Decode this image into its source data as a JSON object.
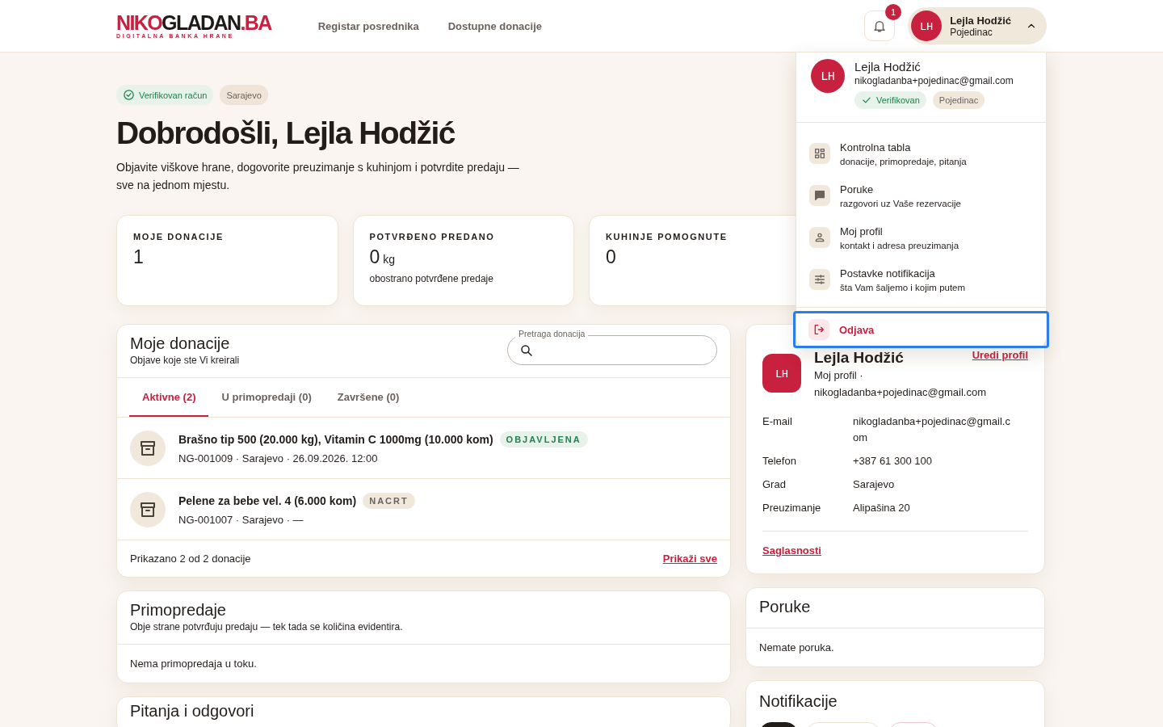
{
  "header": {
    "logo": {
      "parts": [
        {
          "text": "NIKO",
          "color": "#c8203f"
        },
        {
          "text": "GLADAN",
          "color": "#1f1a17"
        },
        {
          "text": ".BA",
          "color": "#c8203f"
        }
      ],
      "tagline": "DIGITALNA BANKA HRANE"
    },
    "nav": [
      {
        "label": "Registar posrednika"
      },
      {
        "label": "Dostupne donacije"
      }
    ],
    "notifications_badge": "1",
    "user": {
      "initials": "LH",
      "name": "Lejla Hodžić",
      "role": "Pojedinac",
      "expanded": true
    }
  },
  "user_menu": {
    "initials": "LH",
    "name": "Lejla Hodžić",
    "email": "nikogladanba+pojedinac@gmail.com",
    "chips": [
      {
        "label": "Verifikovan",
        "kind": "verified"
      },
      {
        "label": "Pojedinac",
        "kind": "plain"
      }
    ],
    "items": [
      {
        "kind": "dashboard",
        "title": "Kontrolna tabla",
        "subtitle": "donacije, primopredaje, pitanja"
      },
      {
        "kind": "messages",
        "title": "Poruke",
        "subtitle": "razgovori uz Vaše rezervacije"
      },
      {
        "kind": "profile",
        "title": "Moj profil",
        "subtitle": "kontakt i adresa preuzimanja"
      },
      {
        "kind": "settings",
        "title": "Postavke notifikacija",
        "subtitle": "šta Vam šaljemo i kojim putem"
      }
    ],
    "logout": {
      "label": "Odjava",
      "focused": true
    }
  },
  "hero": {
    "badges": [
      {
        "label": "Verifikovan račun",
        "kind": "verified"
      },
      {
        "label": "Sarajevo",
        "kind": "plain"
      }
    ],
    "title": "Dobrodošli, Lejla Hodžić",
    "subtitle": "Objavite viškove hrane, dogovorite preuzimanje s kuhinjom i potvrdite predaju — sve na jednom mjestu."
  },
  "stats": [
    {
      "label": "MOJE DONACIJE",
      "value": "1"
    },
    {
      "label": "POTVRĐENO PREDANO",
      "value": "0",
      "unit": "kg",
      "note": "obostrano potvrđene predaje"
    },
    {
      "label": "KUHINJE POMOGNUTE",
      "value": "0"
    }
  ],
  "donations": {
    "title": "Moje donacije",
    "subtitle": "Objave koje ste Vi kreirali",
    "search_label": "Pretraga donacija",
    "tabs": [
      {
        "label": "Aktivne (2)",
        "selected": true
      },
      {
        "label": "U primopredaji (0)",
        "selected": false
      },
      {
        "label": "Završene (0)",
        "selected": false
      }
    ],
    "rows": [
      {
        "title": "Brašno tip 500 (20.000 kg), Vitamin C 1000mg (10.000 kom)",
        "status": {
          "text": "OBJAVLJENA",
          "kind": "published"
        },
        "meta": "NG-001009 · Sarajevo · 26.09.2026. 12:00"
      },
      {
        "title": "Pelene za bebe vel. 4 (6.000 kom)",
        "status": {
          "text": "NACRT",
          "kind": "draft"
        },
        "meta": "NG-001007 · Sarajevo · —"
      }
    ],
    "footer": "Prikazano 2 od 2 donacije",
    "show_all": "Prikaži sve"
  },
  "handovers": {
    "title": "Primopredaje",
    "subtitle": "Obje strane potvrđuju predaju — tek tada se količina evidentira.",
    "empty": "Nema primopredaja u toku."
  },
  "qa": {
    "title": "Pitanja i odgovori"
  },
  "profile": {
    "initials": "LH",
    "name": "Lejla Hodžić",
    "edit_link": "Uredi profil",
    "subtitle": "Moj profil ·",
    "email_line": "nikogladanba+pojedinac@gmail.com",
    "fields": [
      {
        "label": "E-mail",
        "value": "nikogladanba+pojedinac@gmail.com"
      },
      {
        "label": "Telefon",
        "value": "+387 61 300 100"
      },
      {
        "label": "Grad",
        "value": "Sarajevo"
      },
      {
        "label": "Preuzimanje",
        "value": "Alipašina 20"
      }
    ],
    "consents_link": "Saglasnosti"
  },
  "messages": {
    "title": "Poruke",
    "empty": "Nemate poruka."
  },
  "notifications": {
    "title": "Notifikacije",
    "filters": [
      {
        "selected": true,
        "kind": "all"
      },
      {
        "selected": false,
        "kind": "plain"
      },
      {
        "selected": false,
        "kind": "unread"
      }
    ]
  }
}
